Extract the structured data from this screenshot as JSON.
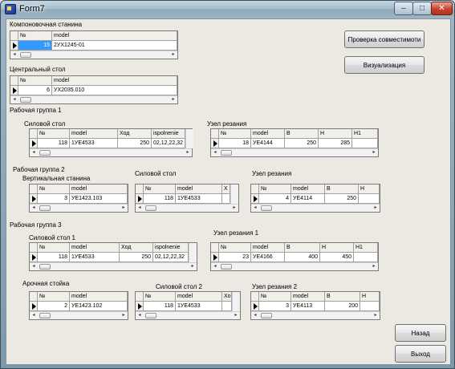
{
  "window": {
    "title": "Form7",
    "min": "–",
    "max": "□",
    "close": "✕"
  },
  "labels": {
    "kompon": "Компоновочная станина",
    "central": "Центральный стол",
    "rg1": "Рабочая группа 1",
    "rg1_silovoy": "Силовой стол",
    "rg1_uzel": "Узел резания",
    "rg2": "Рабочая группа 2",
    "rg2_vert": "Вертикальная станина",
    "rg2_silovoy": "Силовой стол",
    "rg2_uzel": "Узел резания",
    "rg3": "Рабочая группа 3",
    "rg3_silovoy1": "Силовой стол 1",
    "rg3_uzel1": "Узел резания 1",
    "rg3_arch": "Арочная стойка",
    "rg3_silovoy2": "Силовой стол 2",
    "rg3_uzel2": "Узел резания 2"
  },
  "buttons": {
    "check": "Проверка совместимоти",
    "visual": "Визуализация",
    "back": "Назад",
    "exit": "Выход"
  },
  "grids": {
    "kompon": {
      "headers": [
        "№",
        "model"
      ],
      "row": [
        "15",
        "2УХ1245-01"
      ]
    },
    "central": {
      "headers": [
        "№",
        "model"
      ],
      "row": [
        "6",
        "УХ2035.010"
      ]
    },
    "rg1_silovoy": {
      "headers": [
        "№",
        "model",
        "Ход",
        "ispolnenie"
      ],
      "row": [
        "118",
        "1УЕ4533",
        "250",
        "02,12,22,32"
      ]
    },
    "rg1_uzel": {
      "headers": [
        "№",
        "model",
        "B",
        "H",
        "H1"
      ],
      "row": [
        "18",
        "УЕ4144",
        "250",
        "285",
        ""
      ]
    },
    "rg2_vert": {
      "headers": [
        "№",
        "model"
      ],
      "row": [
        "3",
        "УЕ1423.103"
      ]
    },
    "rg2_silovoy": {
      "headers": [
        "№",
        "model",
        "Х"
      ],
      "row": [
        "118",
        "1УЕ4533",
        ""
      ]
    },
    "rg2_uzel": {
      "headers": [
        "№",
        "model",
        "B",
        "H"
      ],
      "row": [
        "4",
        "УЕ4114",
        "250",
        ""
      ]
    },
    "rg3_silovoy1": {
      "headers": [
        "№",
        "model",
        "Ход",
        "ispolnenie"
      ],
      "row": [
        "118",
        "1УЕ4533",
        "250",
        "02,12,22,32"
      ]
    },
    "rg3_uzel1": {
      "headers": [
        "№",
        "model",
        "B",
        "H",
        "H1"
      ],
      "row": [
        "23",
        "УЕ4166",
        "400",
        "450",
        ""
      ]
    },
    "rg3_arch": {
      "headers": [
        "№",
        "model"
      ],
      "row": [
        "2",
        "УЕ1423.102"
      ]
    },
    "rg3_silovoy2": {
      "headers": [
        "№",
        "model",
        "Хо"
      ],
      "row": [
        "118",
        "1УЕ4533",
        ""
      ]
    },
    "rg3_uzel2": {
      "headers": [
        "№",
        "model",
        "B",
        "H"
      ],
      "row": [
        "3",
        "УЕ4113",
        "200",
        ""
      ]
    }
  }
}
